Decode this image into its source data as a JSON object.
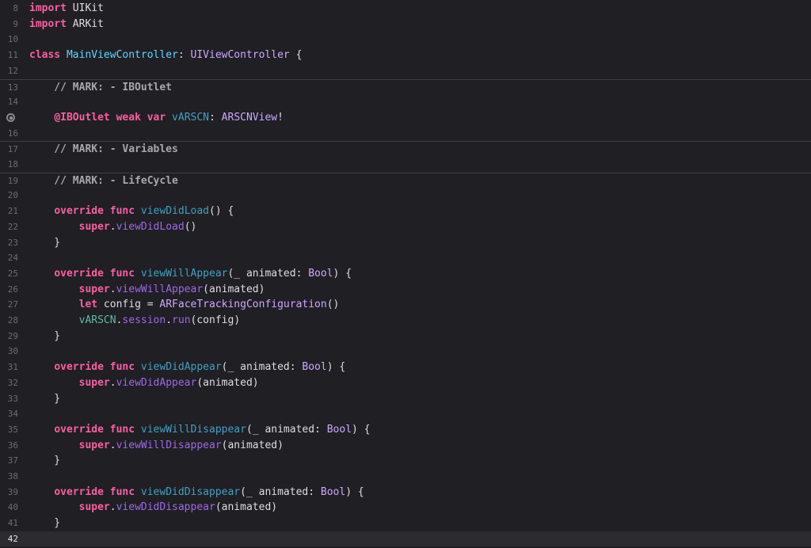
{
  "editor": {
    "colors": {
      "background": "#1f1f24",
      "current_line": "#2b2b31",
      "line_number": "#6c6c72",
      "keyword": "#fc5fa3",
      "plain": "#dfdfe0",
      "comment": "#a7a7ad",
      "type_declaration": "#5dd8ff",
      "type_reference": "#d0a8ff",
      "local_declaration": "#41a1c0",
      "library_member": "#a167e6",
      "instance_property": "#67b7a4"
    },
    "breakpoint_icon": "breakpoint-icon",
    "lines": [
      {
        "num": "8",
        "tokens": [
          {
            "t": "import",
            "c": "kw"
          },
          {
            "t": " UIKit",
            "c": "pl"
          }
        ]
      },
      {
        "num": "9",
        "tokens": [
          {
            "t": "import",
            "c": "kw"
          },
          {
            "t": " ARKit",
            "c": "pl"
          }
        ]
      },
      {
        "num": "10",
        "tokens": []
      },
      {
        "num": "11",
        "tokens": [
          {
            "t": "class",
            "c": "kw"
          },
          {
            "t": " ",
            "c": "pl"
          },
          {
            "t": "MainViewController",
            "c": "ty"
          },
          {
            "t": ": ",
            "c": "pl"
          },
          {
            "t": "UIViewController",
            "c": "tr"
          },
          {
            "t": " {",
            "c": "pl"
          }
        ]
      },
      {
        "num": "12",
        "tokens": []
      },
      {
        "num": "13",
        "mark": true,
        "tokens": [
          {
            "t": "    // MARK: - IBOutlet",
            "c": "cm"
          }
        ]
      },
      {
        "num": "14",
        "tokens": []
      },
      {
        "num": "",
        "breakpoint": true,
        "tokens": [
          {
            "t": "    ",
            "c": "pl"
          },
          {
            "t": "@IBOutlet",
            "c": "kw"
          },
          {
            "t": " ",
            "c": "pl"
          },
          {
            "t": "weak",
            "c": "kw"
          },
          {
            "t": " ",
            "c": "pl"
          },
          {
            "t": "var",
            "c": "kw"
          },
          {
            "t": " ",
            "c": "pl"
          },
          {
            "t": "vARSCN",
            "c": "ld"
          },
          {
            "t": ": ",
            "c": "pl"
          },
          {
            "t": "ARSCNView",
            "c": "tr"
          },
          {
            "t": "!",
            "c": "pl"
          }
        ]
      },
      {
        "num": "16",
        "tokens": []
      },
      {
        "num": "17",
        "mark": true,
        "tokens": [
          {
            "t": "    // MARK: - Variables",
            "c": "cm"
          }
        ]
      },
      {
        "num": "18",
        "tokens": []
      },
      {
        "num": "19",
        "mark": true,
        "tokens": [
          {
            "t": "    // MARK: - LifeCycle",
            "c": "cm"
          }
        ]
      },
      {
        "num": "20",
        "tokens": []
      },
      {
        "num": "21",
        "tokens": [
          {
            "t": "    ",
            "c": "pl"
          },
          {
            "t": "override",
            "c": "kw"
          },
          {
            "t": " ",
            "c": "pl"
          },
          {
            "t": "func",
            "c": "kw"
          },
          {
            "t": " ",
            "c": "pl"
          },
          {
            "t": "viewDidLoad",
            "c": "ld"
          },
          {
            "t": "() {",
            "c": "pl"
          }
        ]
      },
      {
        "num": "22",
        "tokens": [
          {
            "t": "        ",
            "c": "pl"
          },
          {
            "t": "super",
            "c": "kw"
          },
          {
            "t": ".",
            "c": "pl"
          },
          {
            "t": "viewDidLoad",
            "c": "lm"
          },
          {
            "t": "()",
            "c": "pl"
          }
        ]
      },
      {
        "num": "23",
        "tokens": [
          {
            "t": "    }",
            "c": "pl"
          }
        ]
      },
      {
        "num": "24",
        "tokens": []
      },
      {
        "num": "25",
        "tokens": [
          {
            "t": "    ",
            "c": "pl"
          },
          {
            "t": "override",
            "c": "kw"
          },
          {
            "t": " ",
            "c": "pl"
          },
          {
            "t": "func",
            "c": "kw"
          },
          {
            "t": " ",
            "c": "pl"
          },
          {
            "t": "viewWillAppear",
            "c": "ld"
          },
          {
            "t": "(_ animated: ",
            "c": "pl"
          },
          {
            "t": "Bool",
            "c": "tr"
          },
          {
            "t": ") {",
            "c": "pl"
          }
        ]
      },
      {
        "num": "26",
        "tokens": [
          {
            "t": "        ",
            "c": "pl"
          },
          {
            "t": "super",
            "c": "kw"
          },
          {
            "t": ".",
            "c": "pl"
          },
          {
            "t": "viewWillAppear",
            "c": "lm"
          },
          {
            "t": "(animated)",
            "c": "pl"
          }
        ]
      },
      {
        "num": "27",
        "tokens": [
          {
            "t": "        ",
            "c": "pl"
          },
          {
            "t": "let",
            "c": "kw"
          },
          {
            "t": " config = ",
            "c": "pl"
          },
          {
            "t": "ARFaceTrackingConfiguration",
            "c": "tr"
          },
          {
            "t": "()",
            "c": "pl"
          }
        ]
      },
      {
        "num": "28",
        "tokens": [
          {
            "t": "        ",
            "c": "pl"
          },
          {
            "t": "vARSCN",
            "c": "ip"
          },
          {
            "t": ".",
            "c": "pl"
          },
          {
            "t": "session",
            "c": "lm"
          },
          {
            "t": ".",
            "c": "pl"
          },
          {
            "t": "run",
            "c": "lm"
          },
          {
            "t": "(config)",
            "c": "pl"
          }
        ]
      },
      {
        "num": "29",
        "tokens": [
          {
            "t": "    }",
            "c": "pl"
          }
        ]
      },
      {
        "num": "30",
        "tokens": []
      },
      {
        "num": "31",
        "tokens": [
          {
            "t": "    ",
            "c": "pl"
          },
          {
            "t": "override",
            "c": "kw"
          },
          {
            "t": " ",
            "c": "pl"
          },
          {
            "t": "func",
            "c": "kw"
          },
          {
            "t": " ",
            "c": "pl"
          },
          {
            "t": "viewDidAppear",
            "c": "ld"
          },
          {
            "t": "(_ animated: ",
            "c": "pl"
          },
          {
            "t": "Bool",
            "c": "tr"
          },
          {
            "t": ") {",
            "c": "pl"
          }
        ]
      },
      {
        "num": "32",
        "tokens": [
          {
            "t": "        ",
            "c": "pl"
          },
          {
            "t": "super",
            "c": "kw"
          },
          {
            "t": ".",
            "c": "pl"
          },
          {
            "t": "viewDidAppear",
            "c": "lm"
          },
          {
            "t": "(animated)",
            "c": "pl"
          }
        ]
      },
      {
        "num": "33",
        "tokens": [
          {
            "t": "    }",
            "c": "pl"
          }
        ]
      },
      {
        "num": "34",
        "tokens": []
      },
      {
        "num": "35",
        "tokens": [
          {
            "t": "    ",
            "c": "pl"
          },
          {
            "t": "override",
            "c": "kw"
          },
          {
            "t": " ",
            "c": "pl"
          },
          {
            "t": "func",
            "c": "kw"
          },
          {
            "t": " ",
            "c": "pl"
          },
          {
            "t": "viewWillDisappear",
            "c": "ld"
          },
          {
            "t": "(_ animated: ",
            "c": "pl"
          },
          {
            "t": "Bool",
            "c": "tr"
          },
          {
            "t": ") {",
            "c": "pl"
          }
        ]
      },
      {
        "num": "36",
        "tokens": [
          {
            "t": "        ",
            "c": "pl"
          },
          {
            "t": "super",
            "c": "kw"
          },
          {
            "t": ".",
            "c": "pl"
          },
          {
            "t": "viewWillDisappear",
            "c": "lm"
          },
          {
            "t": "(animated)",
            "c": "pl"
          }
        ]
      },
      {
        "num": "37",
        "tokens": [
          {
            "t": "    }",
            "c": "pl"
          }
        ]
      },
      {
        "num": "38",
        "tokens": []
      },
      {
        "num": "39",
        "tokens": [
          {
            "t": "    ",
            "c": "pl"
          },
          {
            "t": "override",
            "c": "kw"
          },
          {
            "t": " ",
            "c": "pl"
          },
          {
            "t": "func",
            "c": "kw"
          },
          {
            "t": " ",
            "c": "pl"
          },
          {
            "t": "viewDidDisappear",
            "c": "ld"
          },
          {
            "t": "(_ animated: ",
            "c": "pl"
          },
          {
            "t": "Bool",
            "c": "tr"
          },
          {
            "t": ") {",
            "c": "pl"
          }
        ]
      },
      {
        "num": "40",
        "tokens": [
          {
            "t": "        ",
            "c": "pl"
          },
          {
            "t": "super",
            "c": "kw"
          },
          {
            "t": ".",
            "c": "pl"
          },
          {
            "t": "viewDidDisappear",
            "c": "lm"
          },
          {
            "t": "(animated)",
            "c": "pl"
          }
        ]
      },
      {
        "num": "41",
        "tokens": [
          {
            "t": "    }",
            "c": "pl"
          }
        ]
      },
      {
        "num": "42",
        "current": true,
        "tokens": []
      }
    ]
  }
}
